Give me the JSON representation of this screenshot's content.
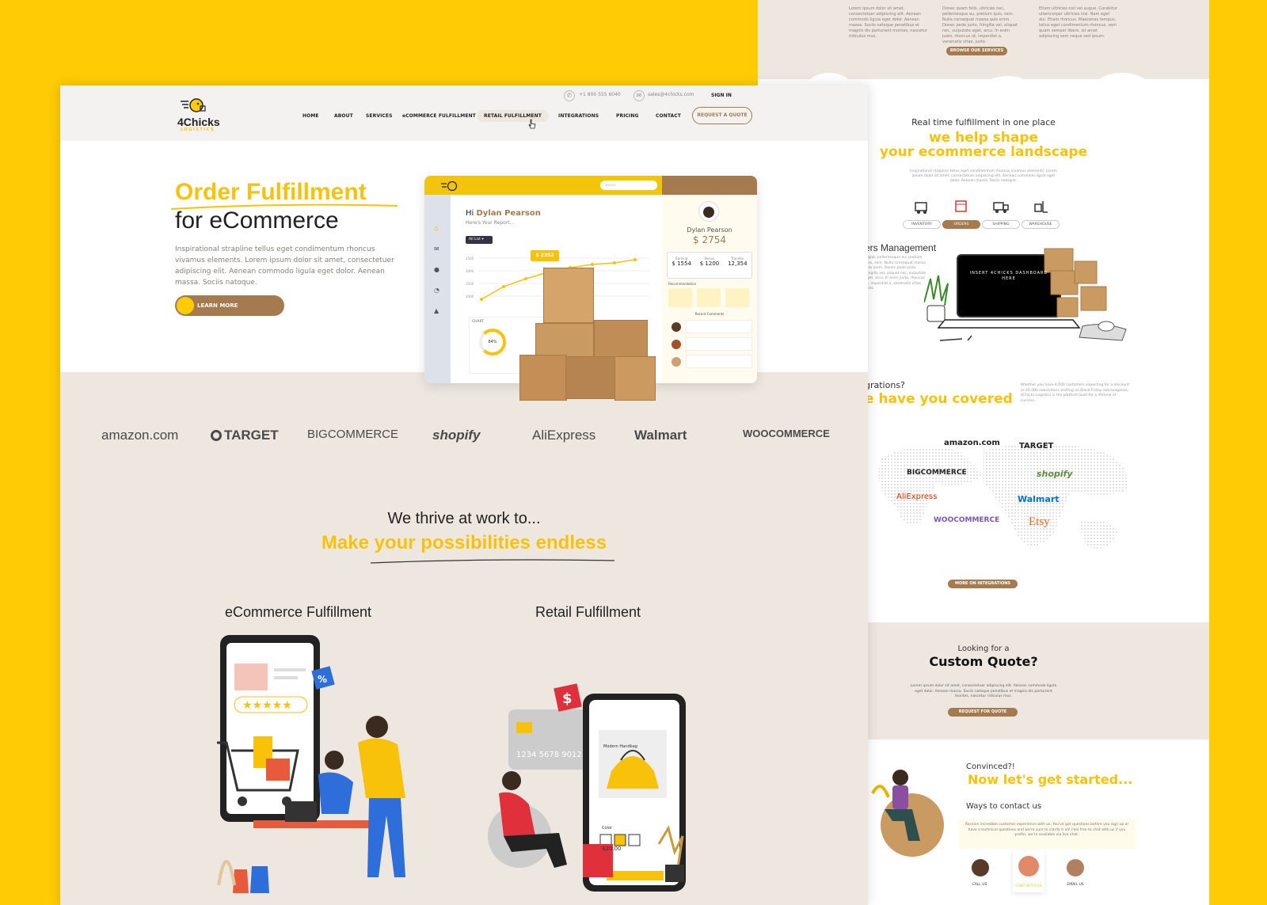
{
  "right_page": {
    "intro_columns": [
      "Lorem ipsum dolor sit amet, consectetuer adipiscing elit. Aenean commodo ligula eget dolor. Aenean massa. Sociis natoque penatibus et magnis dis parturient montes, nascetur ridiculus mus.",
      "Donec quam felis, ultricies nec, pellentesque eu, pretium quis, sem. Nulla consequat massa quis enim. Donec pede justo, fringilla vel, aliquet nec, vulputate eget, arcu. In enim justo, rhoncus ut, imperdiet a, venenatis vitae, justo.",
      "Etiam ultricies nisi vel augue. Curabitur ullamcorper ultricies nisi. Nam eget dui. Etiam rhoncus. Maecenas tempus, tellus eget condimentum rhoncus, sem quam semper libero, sit amet adipiscing sem neque sed ipsum."
    ],
    "browse_services": "BROWSE OUR SERVICES",
    "realtime": "Real time fulfillment in one place",
    "shape_line1": "we help shape",
    "shape_line2": "your ecommerce landscape",
    "shape_body": "Inspirational strapline tellus eget condimentum rhoncus vivamus elements. Lorem ipsum dolor sit amet, consectetuer adipiscing elit. Aenean commodo ligula eget dolor. Aenean massa. Sociis natoque.",
    "tabs": [
      "INVENTORY",
      "ORDERS",
      "SHIPPING",
      "WAREHOUSE"
    ],
    "orders_title": "ers Management",
    "orders_body": "fugiat, pellentesque eu, pretium quis, sem. Nulla consequat massa quis enim. Donec pede justo, fringilla vel, aliquet nec, vulputate eget, arcu. In enim justo, rhoncus ut, imperdiet a, venenatis vitae, justo.",
    "laptop_text": "INSERT 4CHICKS DASHBOARD HERE",
    "integrations_q": "grations?",
    "covered": "e have you covered",
    "covered_body": "Whether you have 4,000 customers expecting for a discount or 40,000 subscribers waiting on Black Friday extravaganza, 4Chicks Logistics is the platform built for a lifetime of success.",
    "partner_logos": [
      "amazon.com",
      "TARGET",
      "BIGCOMMERCE",
      "shopify",
      "AliExpress",
      "Walmart",
      "WOOCOMMERCE",
      "Etsy"
    ],
    "more_integrations": "MORE ON INTEGRATIONS",
    "looking": "Looking for a",
    "custom_quote": "Custom Quote?",
    "quote_body": "Lorem ipsum dolor sit amet, consectetuer adipiscing elit. Aenean commodo ligula eget dolor. Aenean massa. Sociis natoque penatibus et magnis dis parturient montes, nascetur ridiculus mus.",
    "request_quote": "REQUEST FOR QUOTE",
    "convinced": "Convinced?!",
    "get_started": "Now let's get started...",
    "ways": "Ways to contact us",
    "ways_body": "Receive incredible customer experience with us. You've got questions before you sign up or have a technical questions and we're sure to clarify it all! Feel free to chat with us if you prefer, we're available via live chat.",
    "contacts": [
      "CALL US",
      "CHAT WITH US",
      "EMAIL US"
    ]
  },
  "header": {
    "logo_text": "4Chicks",
    "logo_sub": "LOGISTICS",
    "phone": "+1 800 555 6040",
    "email": "sales@4chicks.com",
    "signin": "SIGN IN",
    "nav": [
      "HOME",
      "ABOUT",
      "SERVICES",
      "eCOMMERCE FULFILLMENT",
      "RETAIL FULFILLMENT",
      "INTEGRATIONS",
      "PRICING",
      "CONTACT"
    ],
    "quote_button": "REQUEST A QUOTE"
  },
  "hero": {
    "title_yellow": "Order Fulfillment",
    "title_dark": "for eCommerce",
    "body": "Inspirational strapline tellus eget condimentum rhoncus vivamus elements. Lorem ipsum dolor sit amet, consectetuer adipiscing elit. Aenean commodo ligula eget dolor. Aenean massa. Sociis natoque.",
    "cta": "LEARN MORE"
  },
  "dashboard": {
    "search_placeholder": "Search",
    "greeting": "Hi",
    "user": "Dylan Pearson",
    "report": "Here's Your Report...",
    "filter": "All List",
    "tooltip": "$ 2352",
    "y_ticks": [
      "2500",
      "2000",
      "1500",
      "1000"
    ],
    "chart_label": "CHART",
    "donut_value": "84%",
    "balance": "$ 2754",
    "stats": [
      {
        "label": "Earning",
        "value": "$ 1554"
      },
      {
        "label": "Bonus",
        "value": "$ 1200"
      },
      {
        "label": "Transfer",
        "value": "12,354"
      }
    ],
    "recommendation": "Recommendation",
    "recent_comments": "Recent Comments"
  },
  "brands": [
    "amazon.com",
    "TARGET",
    "BIGCOMMERCE",
    "shopify",
    "AliExpress",
    "Walmart",
    "WOOCOMMERCE"
  ],
  "thrive": {
    "line1": "We thrive at work to...",
    "line2": "Make your possibilities endless"
  },
  "cards": {
    "ecommerce": "eCommerce Fulfillment",
    "retail": "Retail Fulfillment",
    "phone_product": "Modern Handbag",
    "phone_color": "Color",
    "phone_price": "$20.00",
    "phone_cart": "ADD TO CART",
    "card_number": "1234 5678 9012 345"
  }
}
